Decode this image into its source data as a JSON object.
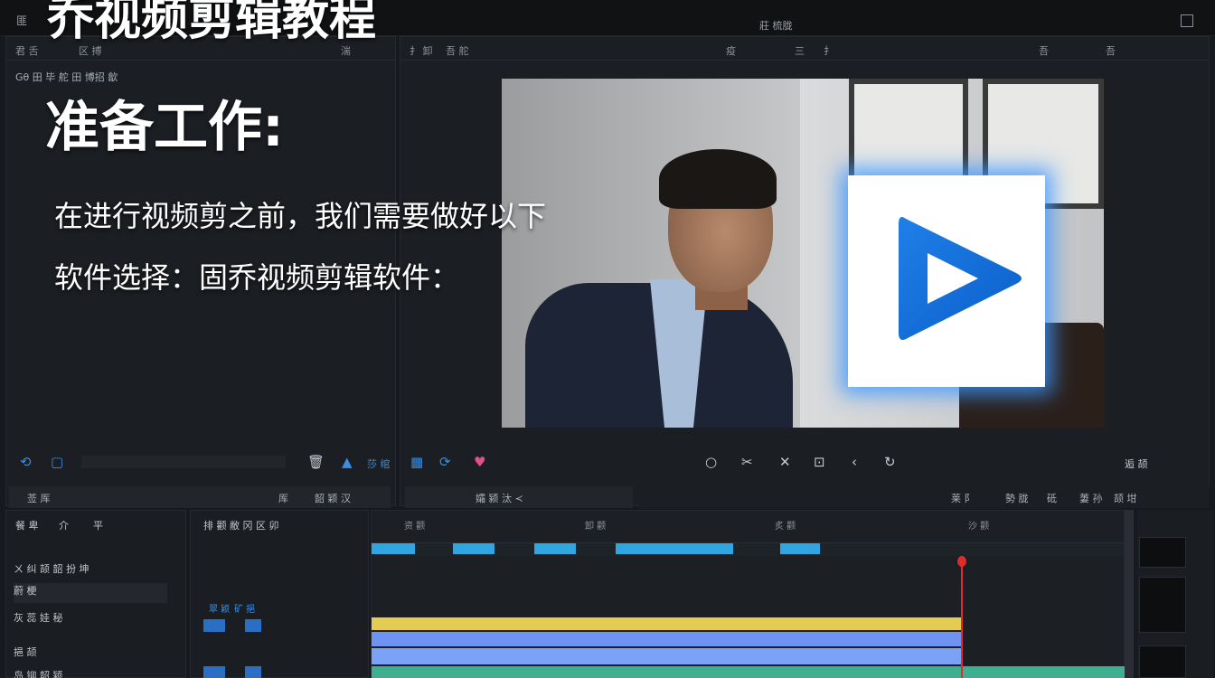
{
  "topbar": {
    "left_label": "匪",
    "center_label": "莊 梳胧",
    "overlay_title": "乔视频剪辑教程"
  },
  "slide": {
    "heading": "准备工作:",
    "line1": "在进行视频剪之前，我们需要做好以下",
    "line2": "软件选择：固乔视频剪辑软件："
  },
  "left_panel": {
    "header_items": [
      "君 舌",
      "区 搏",
      "湍"
    ],
    "secondary_label": "Gθ 田  毕 舵 田 博招 歙"
  },
  "viewer_panel": {
    "header_items": [
      "扌 卸",
      "吾 舵",
      "疫",
      "三",
      "扌",
      "吾",
      "吾"
    ]
  },
  "controls_left": {
    "icons": [
      "undo-icon",
      "square-icon",
      "trash-icon",
      "bell-icon"
    ],
    "right_label": "莎 绾"
  },
  "controls_right": {
    "icons": [
      "grid-icon",
      "loop-icon",
      "heart-icon",
      "circle-icon",
      "scissors-icon",
      "x-icon",
      "crop-icon",
      "back-icon",
      "refresh-icon"
    ],
    "right_label": "逅 颉"
  },
  "status": {
    "left_a": "莶 厍",
    "left_b": "厍",
    "left_c": "韶 颖 汉",
    "mid": "孀 颍 汰 ≺",
    "right": [
      "莱 阝",
      "勢 胧",
      "砥",
      "萋 孙",
      "颉 坩"
    ]
  },
  "media": {
    "tabs": [
      "餐 卑",
      "介",
      "平"
    ],
    "rows": [
      "ㄨ 纠 颉 韶 扮 坤",
      "蔚 梗",
      "灰 蕊 娃 秘",
      "挹 颉",
      "岛 铆 韶 颍"
    ]
  },
  "track_head": {
    "title": "排 颧 敝 冈 区 卯",
    "labels": [
      "翠 颖",
      "矿 挹"
    ]
  },
  "timeline": {
    "ruler_labels": [
      "资 颧",
      "卸 颧",
      "炙 颧",
      "沙 颧"
    ]
  },
  "colors": {
    "accent_blue": "#3c8de0",
    "playhead_red": "#e02b2b",
    "track_yellow": "#e4cc52",
    "track_blue": "#6f93f2",
    "track_green": "#3fb08f"
  }
}
